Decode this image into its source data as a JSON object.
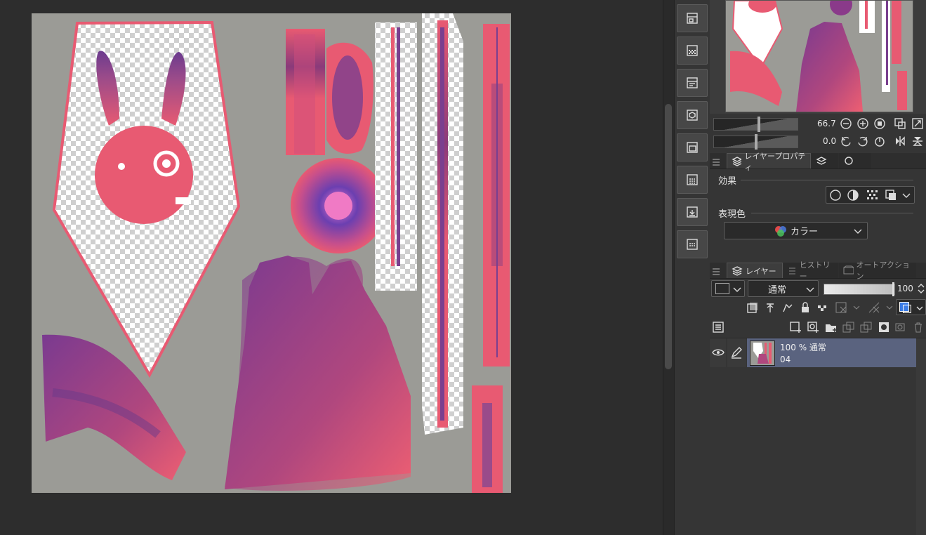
{
  "navigator": {
    "zoom_value": "66.7",
    "rotation_value": "0.0"
  },
  "layer_property": {
    "tab_label": "レイヤープロパティ",
    "effect_label": "効果",
    "expression_color_label": "表現色",
    "expression_color_value": "カラー"
  },
  "layer_panel": {
    "tab_layer": "レイヤー",
    "tab_history": "ヒストリー",
    "tab_auto_action": "オートアクション",
    "blend_mode": "通常",
    "opacity": "100",
    "layers": [
      {
        "title": "100 % 通常",
        "name": "04",
        "visible": true
      }
    ]
  },
  "colors": {
    "canvas_bg": "#9b9b96",
    "accent_pink": "#e85a72",
    "accent_purple": "#7a3f8f",
    "selected_layer": "#5a637f"
  },
  "dock_icons": [
    "layout-icon",
    "grid-pattern-icon",
    "layout-icon-2",
    "cube-icon",
    "image-icon",
    "dot-grid-icon",
    "download-icon",
    "calendar-grid-icon"
  ]
}
